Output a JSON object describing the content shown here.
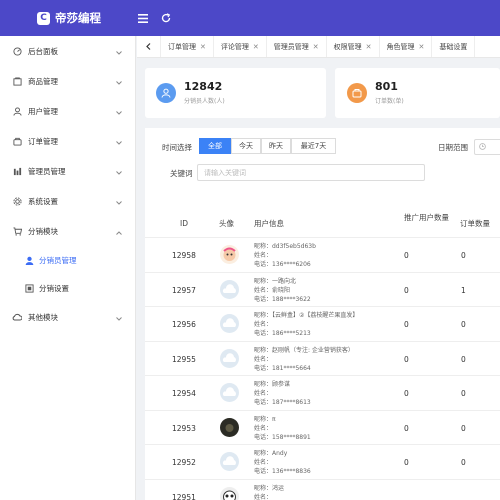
{
  "app": {
    "logo_letter": "C",
    "title": "帝莎编程"
  },
  "topbar": {
    "menu_icon": "hamburger-icon",
    "refresh_icon": "refresh-icon"
  },
  "sidebar": {
    "items": [
      {
        "label": "后台面板",
        "icon": "dashboard-icon"
      },
      {
        "label": "商品管理",
        "icon": "goods-icon"
      },
      {
        "label": "用户管理",
        "icon": "user-icon"
      },
      {
        "label": "订单管理",
        "icon": "order-icon"
      },
      {
        "label": "管理员管理",
        "icon": "admin-icon"
      },
      {
        "label": "系统设置",
        "icon": "gear-icon"
      },
      {
        "label": "分销模块",
        "icon": "cart-icon"
      }
    ],
    "sub_items": [
      {
        "label": "分销员管理",
        "icon": "person-icon",
        "active": true
      },
      {
        "label": "分销设置",
        "icon": "settings-icon",
        "active": false
      }
    ],
    "last_item": {
      "label": "其他模块",
      "icon": "cloud-icon"
    }
  },
  "tabs": [
    "订单管理",
    "评论管理",
    "管理员管理",
    "权限管理",
    "角色管理",
    "基础设置"
  ],
  "stats": [
    {
      "value": "12842",
      "label": "分销员人数(人)",
      "color": "#5b9bf0"
    },
    {
      "value": "801",
      "label": "订单数(单)",
      "color": "#f2994a"
    }
  ],
  "filter": {
    "time_label": "时间选择",
    "time_options": [
      "全部",
      "今天",
      "昨天",
      "最近7天"
    ],
    "active_index": 0,
    "date_label": "日期范围",
    "keyword_label": "关键词",
    "keyword_placeholder": "请输入关键词"
  },
  "table": {
    "headers": {
      "id": "ID",
      "avatar": "头像",
      "info": "用户信息",
      "promoted": "推广用户数量",
      "orders": "订单数量"
    },
    "rows": [
      {
        "id": "12958",
        "nickname": "昵称：dd3f5eb5d63b",
        "name": "姓名：",
        "phone": "电话：136****6206",
        "promoted": "0",
        "orders": "0",
        "avatar": "cartoon"
      },
      {
        "id": "12957",
        "nickname": "昵称：一路向北",
        "name": "姓名：俞晓阳",
        "phone": "电话：188****3622",
        "promoted": "0",
        "orders": "1",
        "avatar": "cloud"
      },
      {
        "id": "12956",
        "nickname": "昵称：【云鲜盒】②【荔枝醒芒果直发】",
        "name": "姓名：",
        "phone": "电话：186****5213",
        "promoted": "0",
        "orders": "0",
        "avatar": "cloud"
      },
      {
        "id": "12955",
        "nickname": "昵称：赵刚帆（专注: 企业营销获客）",
        "name": "姓名：",
        "phone": "电话：181****5664",
        "promoted": "0",
        "orders": "0",
        "avatar": "cloud"
      },
      {
        "id": "12954",
        "nickname": "昵称：顾参谋",
        "name": "姓名：",
        "phone": "电话：187****8613",
        "promoted": "0",
        "orders": "0",
        "avatar": "cloud"
      },
      {
        "id": "12953",
        "nickname": "昵称：π",
        "name": "姓名：",
        "phone": "电话：158****8891",
        "promoted": "0",
        "orders": "0",
        "avatar": "dark"
      },
      {
        "id": "12952",
        "nickname": "昵称：Andy",
        "name": "姓名：",
        "phone": "电话：136****8836",
        "promoted": "0",
        "orders": "0",
        "avatar": "cloud"
      },
      {
        "id": "12951",
        "nickname": "昵称：鸿运",
        "name": "姓名：",
        "phone": "",
        "promoted": "",
        "orders": "",
        "avatar": "panda"
      }
    ]
  }
}
